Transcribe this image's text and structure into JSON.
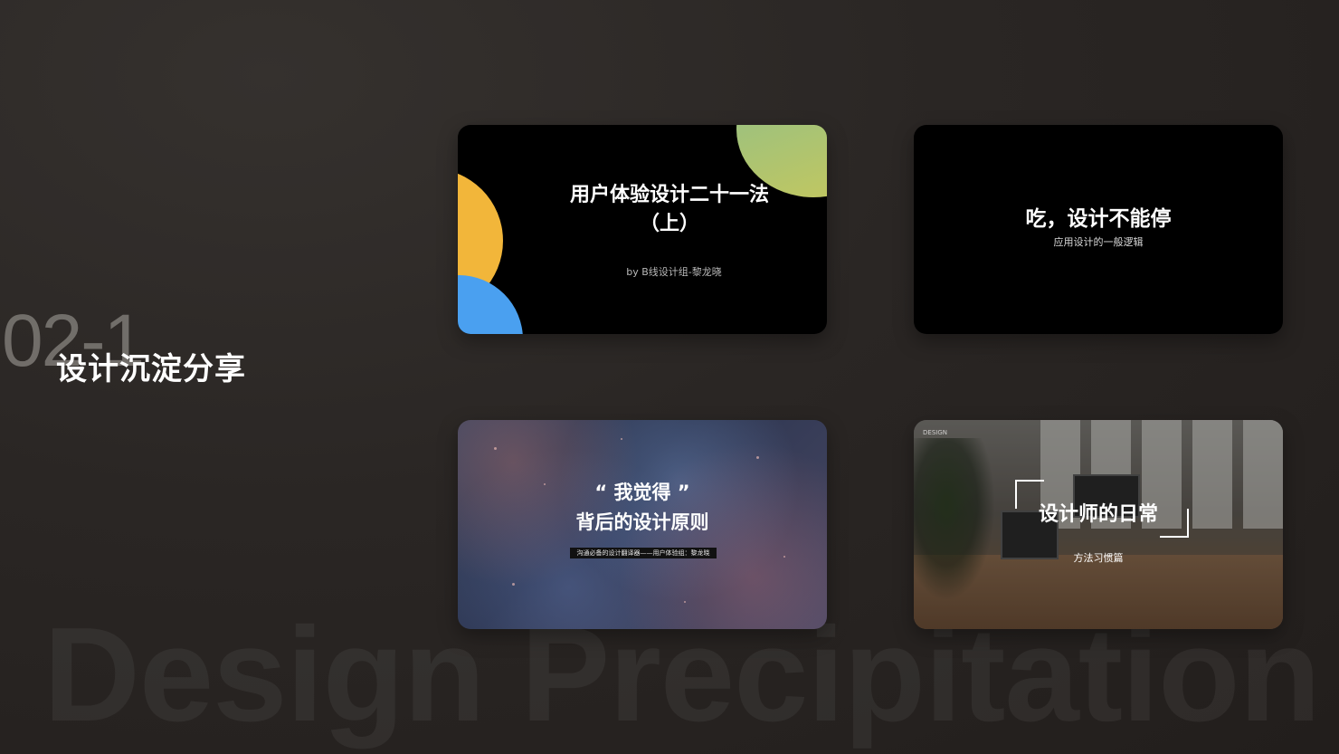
{
  "page": {
    "watermark": "Design Precipitation",
    "section_number": "02-1",
    "section_title": "设计沉淀分享"
  },
  "cards": [
    {
      "title_line1": "用户体验设计二十一法",
      "title_line2": "（上）",
      "byline": "by B线设计组-黎龙晓"
    },
    {
      "title": "吃，设计不能停",
      "subtitle": "应用设计的一般逻辑"
    },
    {
      "quote": "“ 我觉得 ”",
      "title": "背后的设计原则",
      "tag": "沟通必备的设计翻译器——用户体验组：黎龙晓"
    },
    {
      "small_text": "DESIGN",
      "title": "设计师的日常",
      "subtitle": "方法习惯篇"
    }
  ],
  "colors": {
    "card1_green": "#b5c56a",
    "card1_yellow": "#f2b63a",
    "card1_blue": "#4aa0f0"
  }
}
